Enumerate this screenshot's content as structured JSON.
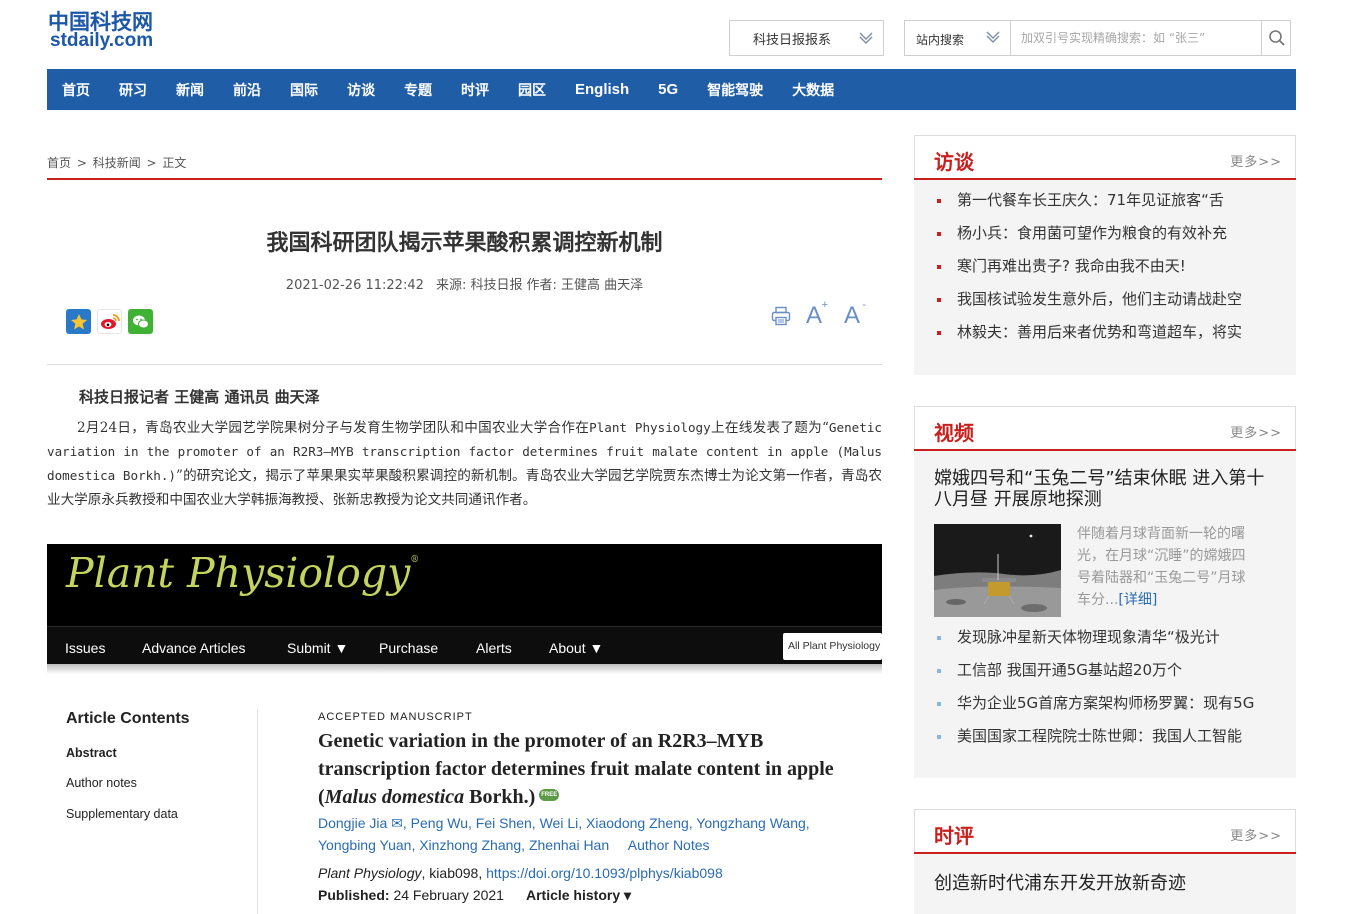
{
  "header": {
    "logo_cn": "中国科技网",
    "logo_en": "stdaily.com",
    "paper_select": "科技日报报系",
    "search_scope": "站内搜索",
    "search_placeholder": "加双引号实现精确搜索：如 “张三”"
  },
  "nav": [
    "首页",
    "研习",
    "新闻",
    "前沿",
    "国际",
    "访谈",
    "专题",
    "时评",
    "园区",
    "English",
    "5G",
    "智能驾驶",
    "大数据"
  ],
  "breadcrumb": [
    "首页",
    "科技新闻",
    "正文"
  ],
  "article": {
    "title": "我国科研团队揭示苹果酸积累调控新机制",
    "datetime": "2021-02-26 11:22:42",
    "source": "来源: 科技日报",
    "author": "作者: 王健高 曲天泽",
    "byline": "科技日报记者 王健高 通讯员 曲天泽",
    "body_p1": "2月24日，青岛农业大学园艺学院果树分子与发育生物学团队和中国农业大学合作在",
    "body_journal": "Plant Physiology",
    "body_p2": "上在线发表了题为“",
    "body_en_title": "Genetic variation in the promoter of an R2R3–MYB transcription factor determines fruit malate content in apple (Malus domestica Borkh.)",
    "body_p3": "”的研究论文，揭示了苹果果实苹果酸积累调控的新机制。青岛农业大学园艺学院贾东杰博士为论文第一作者，青岛农业大学原永兵教授和中国农业大学韩振海教授、张新忠教授为论文共同通讯作者。"
  },
  "embedded": {
    "journal": "Plant Physiology",
    "journal_mark": "®",
    "nav": [
      "Issues",
      "Advance Articles",
      "Submit ▼",
      "Purchase",
      "Alerts",
      "About ▼"
    ],
    "search": "All Plant Physiology",
    "contents_heading": "Article Contents",
    "contents_items": [
      "Abstract",
      "Author notes",
      "Supplementary data"
    ],
    "accepted": "ACCEPTED MANUSCRIPT",
    "title_1": "Genetic variation in the promoter of an R2R3–MYB transcription factor determines fruit malate content in apple (",
    "title_italic": "Malus domestica",
    "title_2": " Borkh.)",
    "free_badge": "FREE",
    "authors_1": "Dongjie Jia ✉, Peng Wu, Fei Shen, Wei Li, Xiaodong Zheng, Yongzhang Wang,",
    "authors_2": "Yongbing Yuan, Xinzhong Zhang, Zhenhai Han     Author Notes",
    "cite_journal": "Plant Physiology",
    "cite_id": ", kiab098, ",
    "cite_doi": "https://doi.org/10.1093/plphys/kiab098",
    "published_label": "Published:",
    "published_date": " 24 February 2021",
    "history": "Article history ▾"
  },
  "sidebar": {
    "interview": {
      "title": "访谈",
      "more": "更多>>",
      "items": [
        "第一代餐车长王庆久：71年见证旅客“舌",
        "杨小兵：食用菌可望作为粮食的有效补充",
        "寒门再难出贵子? 我命由我不由天!",
        "我国核试验发生意外后，他们主动请战赴空",
        "林毅夫：善用后来者优势和弯道超车，将实"
      ]
    },
    "video": {
      "title": "视频",
      "more": "更多>>",
      "headline": "嫦娥四号和“玉兔二号”结束休眠 进入第十八月昼 开展原地探测",
      "desc": "伴随着月球背面新一轮的曙光，在月球“沉睡”的嫦娥四号着陆器和“玉兔二号”月球车分...",
      "detail": "[详细]",
      "items": [
        "发现脉冲星新天体物理现象清华“极光计",
        "工信部 我国开通5G基站超20万个",
        "华为企业5G首席方案架构师杨罗翼：现有5G",
        "美国国家工程院院士陈世卿：我国人工智能"
      ]
    },
    "comment": {
      "title": "时评",
      "more": "更多>>",
      "headline": "创造新时代浦东开发开放新奇迹"
    }
  }
}
